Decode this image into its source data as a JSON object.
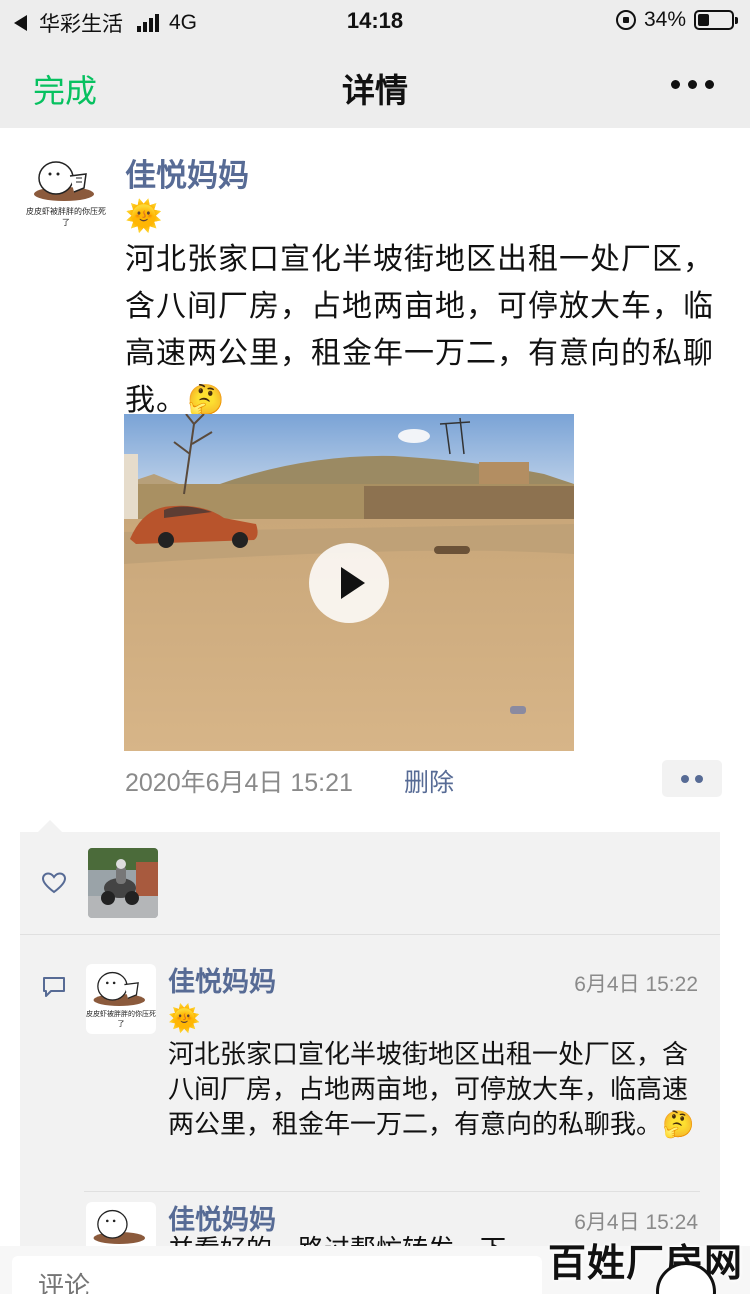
{
  "status_bar": {
    "carrier": "华彩生活",
    "network": "4G",
    "time": "14:18",
    "battery": "34%",
    "battery_fraction": 0.34
  },
  "nav": {
    "done_label": "完成",
    "title": "详情",
    "more_icon": "more-dots-icon"
  },
  "post": {
    "avatar_caption": "皮皮虾被胖胖的你压死了",
    "author": "佳悦妈妈",
    "sun_emoji": "🌞",
    "text": "河北张家口宣化半坡街地区出租一处厂区，含八间厂房，占地两亩地，可停放大车，临高速两公里，租金年一万二，有意向的私聊我。",
    "think_emoji": "🤔",
    "timestamp": "2020年6月4日 15:21",
    "delete_label": "删除"
  },
  "likes": {
    "icon": "heart-icon"
  },
  "comments": [
    {
      "author": "佳悦妈妈",
      "time": "6月4日 15:22",
      "sun_emoji": "🌞",
      "text": "河北张家口宣化半坡街地区出租一处厂区，含八间厂房，占地两亩地，可停放大车，临高速两公里，租金年一万二，有意向的私聊我。",
      "think_emoji": "🤔"
    },
    {
      "author": "佳悦妈妈",
      "time": "6月4日 15:24",
      "text": "并看好的，路过帮忙转发一下"
    }
  ],
  "input": {
    "placeholder": "评论"
  },
  "watermark": "百姓厂房网",
  "colors": {
    "accent_green": "#07c160",
    "link_blue": "#576b95",
    "nav_bg": "#ededed",
    "panel_bg": "#f2f2f2"
  }
}
